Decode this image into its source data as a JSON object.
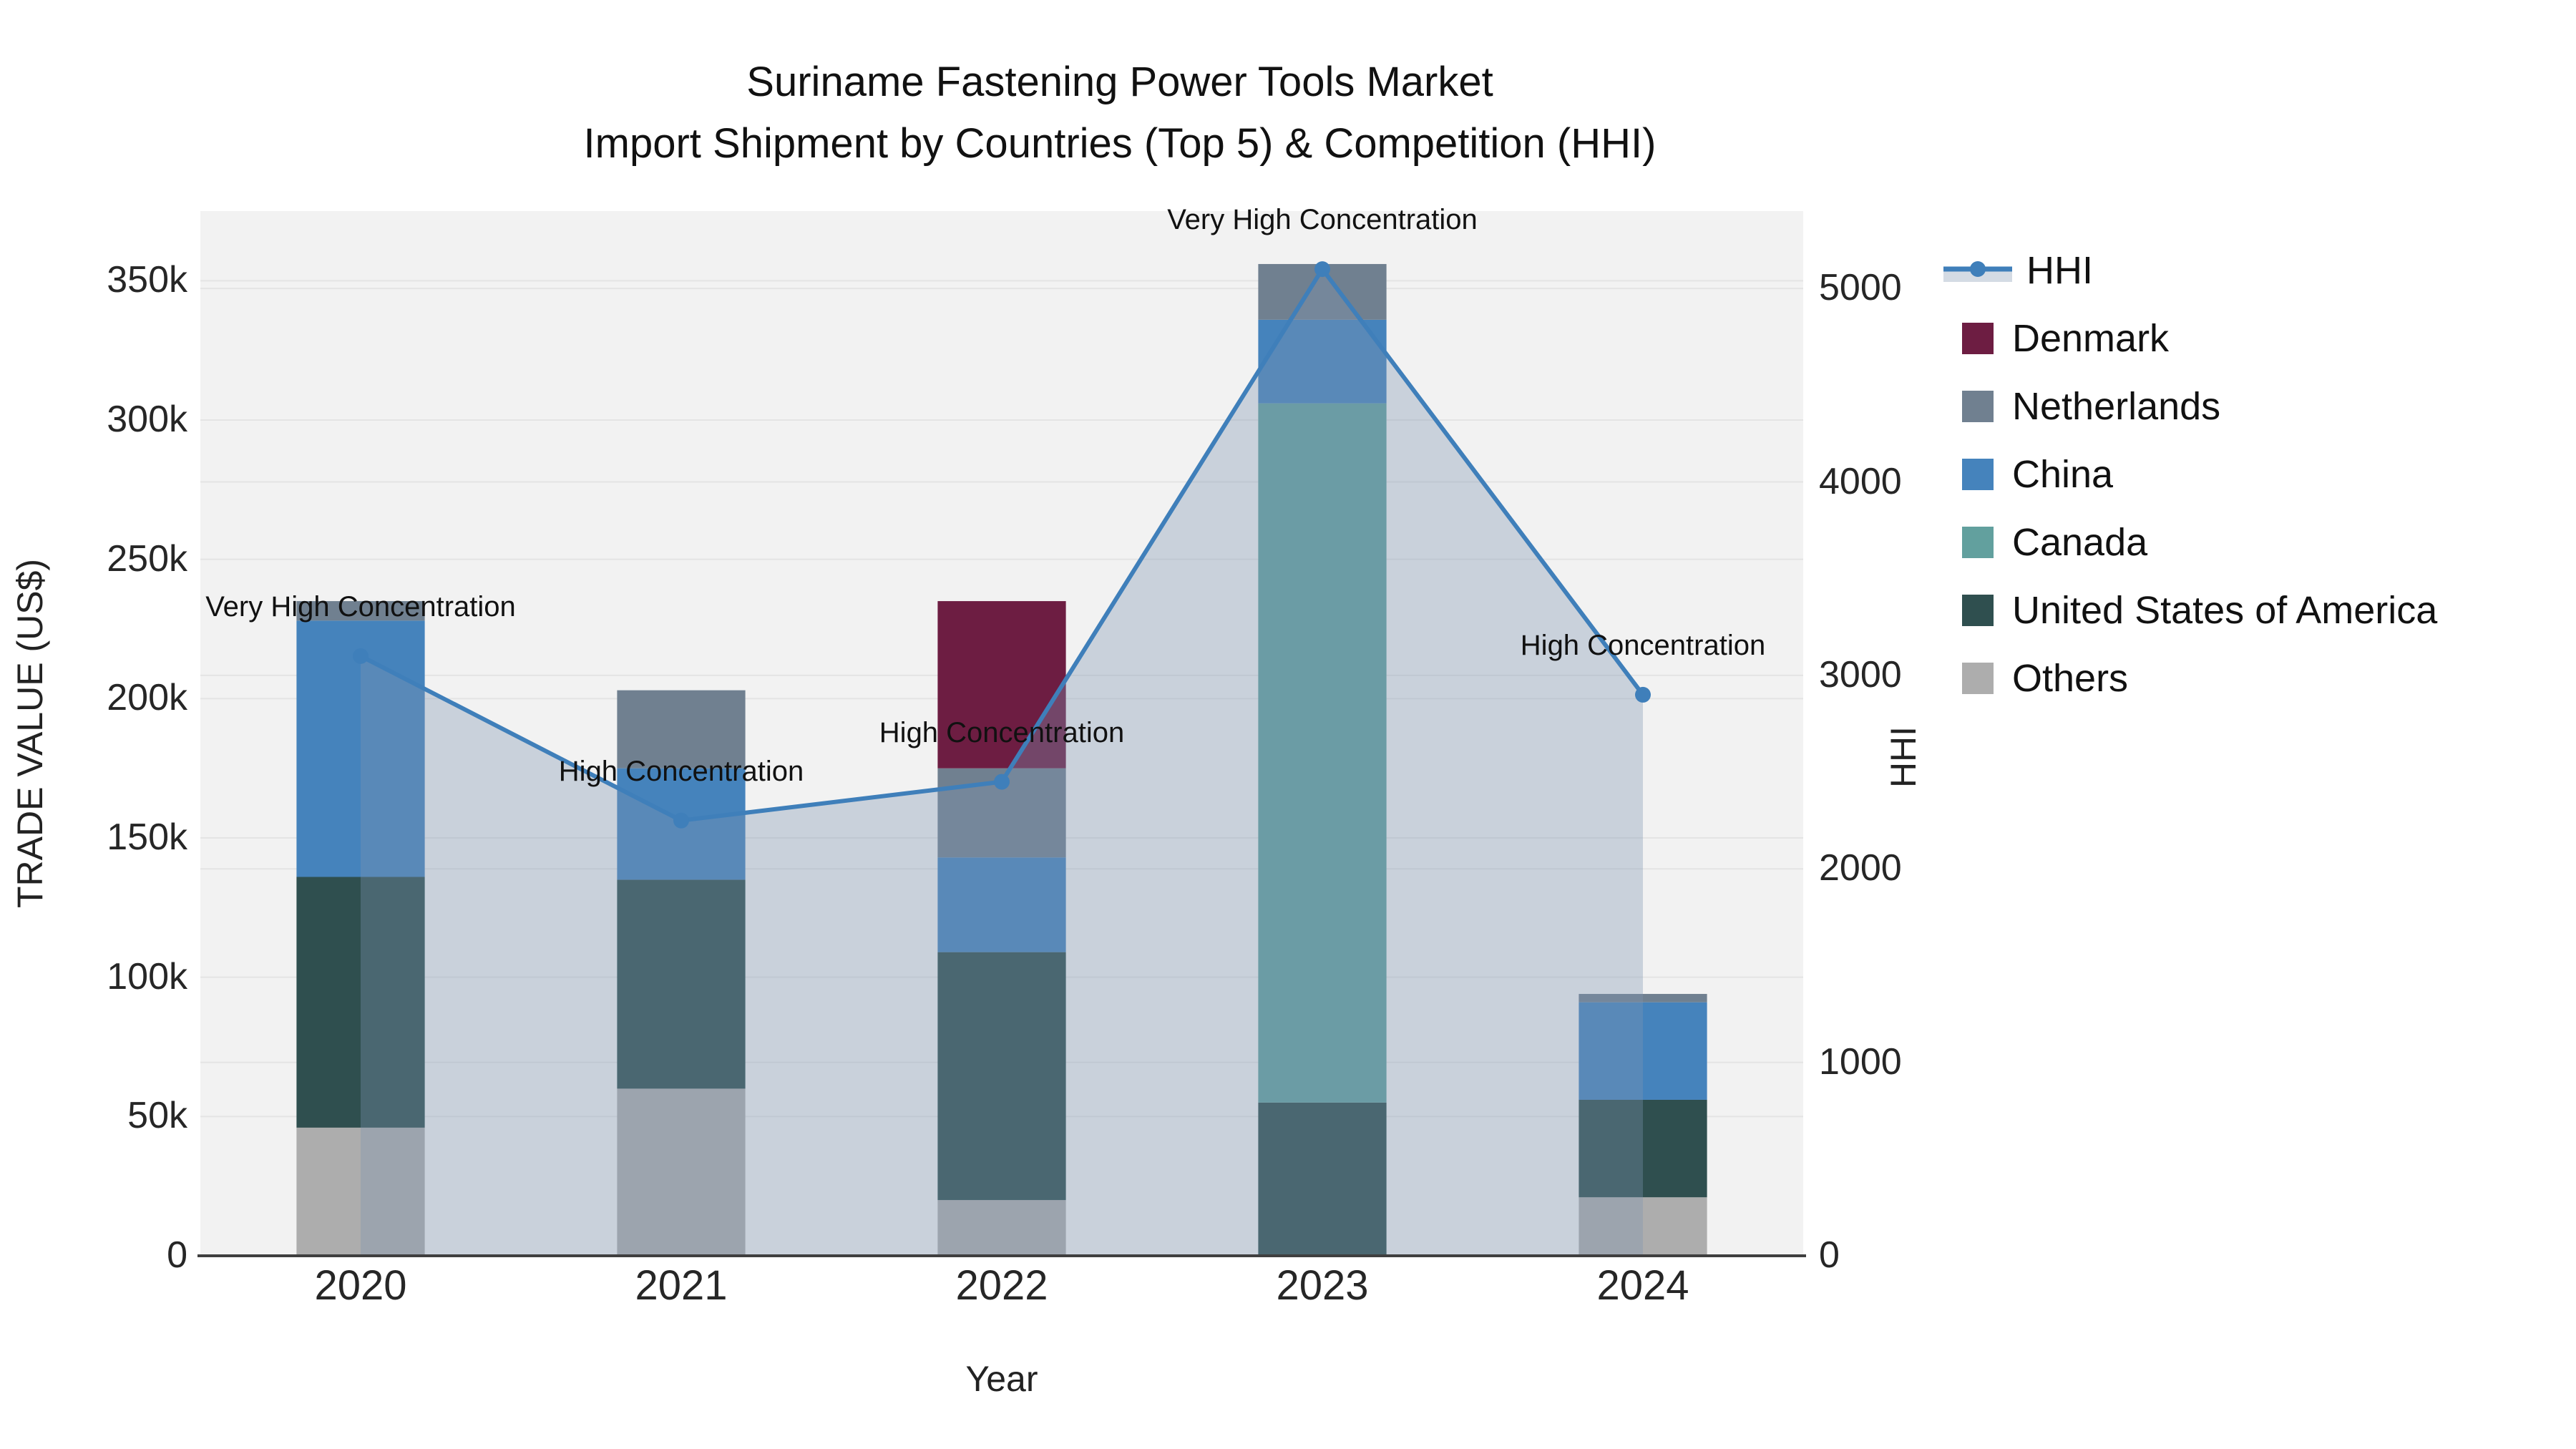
{
  "title": {
    "line1": "Suriname Fastening Power Tools Market",
    "line2": "Import Shipment by Countries (Top 5) & Competition (HHI)"
  },
  "axes": {
    "x_title": "Year",
    "y_left_title": "TRADE VALUE (US$)",
    "y_right_title": "HHI"
  },
  "chart_data": {
    "type": "bar",
    "subtype": "stacked bars with overlaid line (dual axis)",
    "categories": [
      "2020",
      "2021",
      "2022",
      "2023",
      "2024"
    ],
    "xlabel": "Year",
    "ylabel_left": "TRADE VALUE (US$)",
    "ylabel_right": "HHI",
    "y_left": {
      "min": 0,
      "max": 375000,
      "ticks": [
        {
          "v": 0,
          "label": "0"
        },
        {
          "v": 50000,
          "label": "50k"
        },
        {
          "v": 100000,
          "label": "100k"
        },
        {
          "v": 150000,
          "label": "150k"
        },
        {
          "v": 200000,
          "label": "200k"
        },
        {
          "v": 250000,
          "label": "250k"
        },
        {
          "v": 300000,
          "label": "300k"
        },
        {
          "v": 350000,
          "label": "350k"
        }
      ]
    },
    "y_right": {
      "min": 0,
      "max": 5400,
      "ticks": [
        {
          "v": 0,
          "label": "0"
        },
        {
          "v": 1000,
          "label": "1000"
        },
        {
          "v": 2000,
          "label": "2000"
        },
        {
          "v": 3000,
          "label": "3000"
        },
        {
          "v": 4000,
          "label": "4000"
        },
        {
          "v": 5000,
          "label": "5000"
        }
      ]
    },
    "series": [
      {
        "name": "Others",
        "color": "#ADADAD",
        "values": [
          46000,
          60000,
          20000,
          0,
          21000
        ]
      },
      {
        "name": "United States of America",
        "color": "#2F4F4F",
        "values": [
          90000,
          75000,
          89000,
          55000,
          35000
        ]
      },
      {
        "name": "Canada",
        "color": "#62A09E",
        "values": [
          0,
          0,
          0,
          251000,
          0
        ]
      },
      {
        "name": "China",
        "color": "#4583BC",
        "values": [
          92000,
          40000,
          34000,
          30000,
          35000
        ]
      },
      {
        "name": "Netherlands",
        "color": "#708090",
        "values": [
          7000,
          28000,
          32000,
          20000,
          3000
        ]
      },
      {
        "name": "Denmark",
        "color": "#6D1D42",
        "values": [
          0,
          0,
          60000,
          0,
          0
        ]
      }
    ],
    "hhi": {
      "name": "HHI",
      "color": "#3F7FBA",
      "fill_color": "rgba(126,148,177,0.35)",
      "values": [
        3100,
        2250,
        2450,
        5100,
        2900
      ]
    },
    "annotations": [
      "Very High Concentration",
      "High Concentration",
      "High Concentration",
      "Very High Concentration",
      "High Concentration"
    ],
    "legend": [
      {
        "label": "HHI",
        "type": "line",
        "color": "#3F7FBA"
      },
      {
        "label": "Denmark",
        "type": "square",
        "color": "#6D1D42"
      },
      {
        "label": "Netherlands",
        "type": "square",
        "color": "#708090"
      },
      {
        "label": "China",
        "type": "square",
        "color": "#4583BC"
      },
      {
        "label": "Canada",
        "type": "square",
        "color": "#62A09E"
      },
      {
        "label": "United States of America",
        "type": "square",
        "color": "#2F4F4F"
      },
      {
        "label": "Others",
        "type": "square",
        "color": "#ADADAD"
      }
    ],
    "layout_hints": {
      "plot_bg": "#F2F2F2",
      "grid_color": "#E4E4E4",
      "axis_line_color": "#3F3F3F",
      "grid": "on",
      "legend_position": "right"
    }
  }
}
